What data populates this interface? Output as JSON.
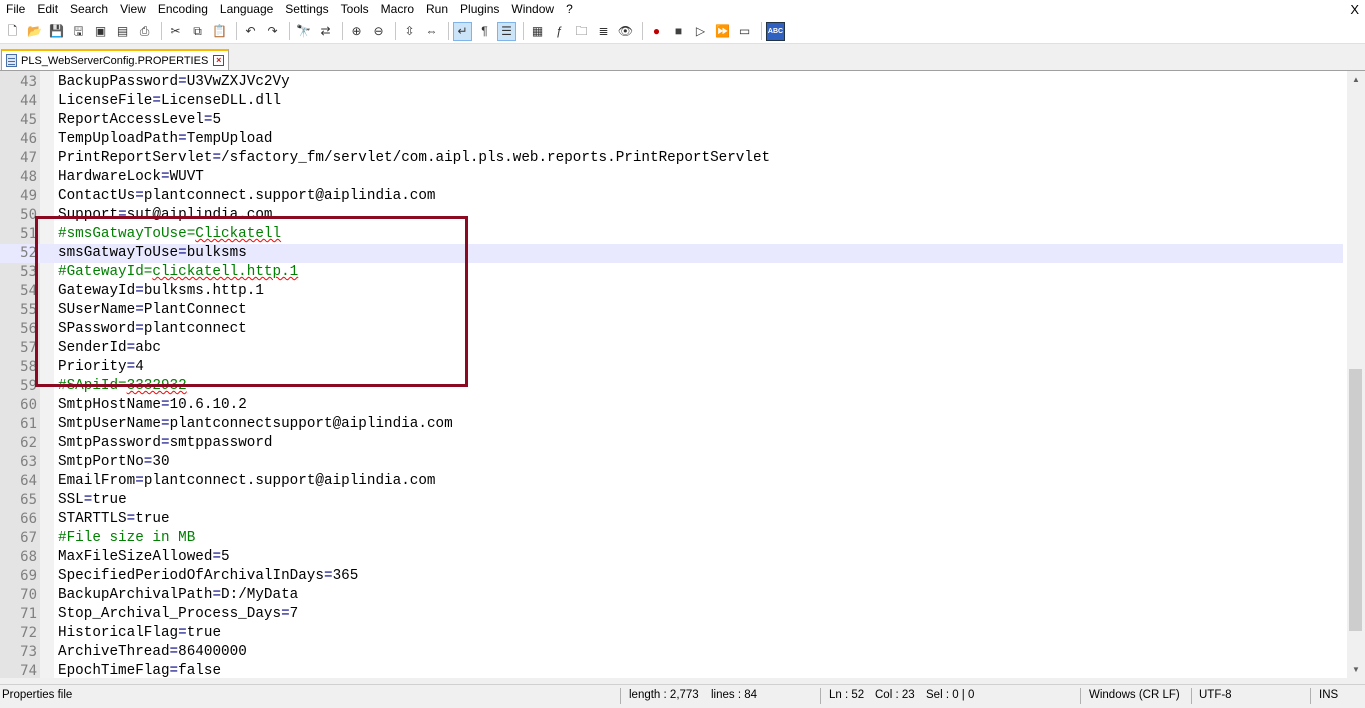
{
  "menu": [
    "File",
    "Edit",
    "Search",
    "View",
    "Encoding",
    "Language",
    "Settings",
    "Tools",
    "Macro",
    "Run",
    "Plugins",
    "Window",
    "?"
  ],
  "window_close": "X",
  "toolbar": {
    "icons": [
      "new-file-icon",
      "open-file-icon",
      "save-icon",
      "save-all-icon",
      "close-icon",
      "close-all-icon",
      "print-icon",
      "cut-icon",
      "copy-icon",
      "paste-icon",
      "undo-icon",
      "redo-icon",
      "find-icon",
      "replace-icon",
      "zoom-in-icon",
      "zoom-out-icon",
      "sync-vertical-icon",
      "sync-horizontal-icon",
      "word-wrap-icon",
      "show-all-chars-icon",
      "indent-guide-icon",
      "doc-map-icon",
      "function-list-icon",
      "folder-workspace-icon",
      "doc-list-icon",
      "monitoring-icon",
      "record-macro-icon",
      "stop-record-icon",
      "playback-macro-icon",
      "run-macro-multiple-icon",
      "save-macro-icon",
      "spell-check-icon"
    ],
    "spell_label": "ABC"
  },
  "tab": {
    "label": "PLS_WebServerConfig.PROPERTIES"
  },
  "editor": {
    "current_line": 52,
    "lines": [
      {
        "n": "43",
        "key": "BackupPassword",
        "eq": "=",
        "val": "U3VwZXJVc2Vy"
      },
      {
        "n": "44",
        "key": "LicenseFile",
        "eq": "=",
        "val": "LicenseDLL.dll"
      },
      {
        "n": "45",
        "key": "ReportAccessLevel",
        "eq": "=",
        "val": "5"
      },
      {
        "n": "46",
        "key": "TempUploadPath",
        "eq": "=",
        "val": "TempUpload"
      },
      {
        "n": "47",
        "key": "PrintReportServlet",
        "eq": "=",
        "val": "/sfactory_fm/servlet/com.aipl.pls.web.reports.PrintReportServlet"
      },
      {
        "n": "48",
        "key": "HardwareLock",
        "eq": "=",
        "val": "WUVT"
      },
      {
        "n": "49",
        "key": "ContactUs",
        "eq": "=",
        "val": "plantconnect.support@aiplindia.com"
      },
      {
        "n": "50",
        "key": "Support",
        "eq": "=",
        "val": "sut@aiplindia.com"
      },
      {
        "n": "51",
        "comment": "#smsGatwayToUse=Clickatell"
      },
      {
        "n": "52",
        "key": "smsGatwayToUse",
        "eq": "=",
        "val": "bulksms"
      },
      {
        "n": "53",
        "comment": "#GatewayId=clickatell.http.1"
      },
      {
        "n": "54",
        "key": "GatewayId",
        "eq": "=",
        "val": "bulksms.http.1"
      },
      {
        "n": "55",
        "key": "SUserName",
        "eq": "=",
        "val": "PlantConnect"
      },
      {
        "n": "56",
        "key": "SPassword",
        "eq": "=",
        "val": "plantconnect"
      },
      {
        "n": "57",
        "key": "SenderId",
        "eq": "=",
        "val": "abc"
      },
      {
        "n": "58",
        "key": "Priority",
        "eq": "=",
        "val": "4"
      },
      {
        "n": "59",
        "comment": "#SApiId=3332932"
      },
      {
        "n": "60",
        "key": "SmtpHostName",
        "eq": "=",
        "val": "10.6.10.2"
      },
      {
        "n": "61",
        "key": "SmtpUserName",
        "eq": "=",
        "val": "plantconnectsupport@aiplindia.com"
      },
      {
        "n": "62",
        "key": "SmtpPassword",
        "eq": "=",
        "val": "smtppassword"
      },
      {
        "n": "63",
        "key": "SmtpPortNo",
        "eq": "=",
        "val": "30"
      },
      {
        "n": "64",
        "key": "EmailFrom",
        "eq": "=",
        "val": "plantconnect.support@aiplindia.com"
      },
      {
        "n": "65",
        "key": "SSL",
        "eq": "=",
        "val": "true"
      },
      {
        "n": "66",
        "key": "STARTTLS",
        "eq": "=",
        "val": "true"
      },
      {
        "n": "67",
        "comment": "#File size in MB"
      },
      {
        "n": "68",
        "key": "MaxFileSizeAllowed",
        "eq": "=",
        "val": "5"
      },
      {
        "n": "69",
        "key": "SpecifiedPeriodOfArchivalInDays",
        "eq": "=",
        "val": "365"
      },
      {
        "n": "70",
        "key": "BackupArchivalPath",
        "eq": "=",
        "val": "D:/MyData"
      },
      {
        "n": "71",
        "key": "Stop_Archival_Process_Days",
        "eq": "=",
        "val": "7"
      },
      {
        "n": "72",
        "key": "HistoricalFlag",
        "eq": "=",
        "val": "true"
      },
      {
        "n": "73",
        "key": "ArchiveThread",
        "eq": "=",
        "val": "86400000"
      },
      {
        "n": "74",
        "key": "EpochTimeFlag",
        "eq": "=",
        "val": "false"
      }
    ]
  },
  "status": {
    "file_type": "Properties file",
    "length": "length : 2,773",
    "lines": "lines : 84",
    "ln": "Ln : 52",
    "col": "Col : 23",
    "sel": "Sel : 0 | 0",
    "eol": "Windows (CR LF)",
    "encoding": "UTF-8",
    "mode": "INS"
  },
  "colors": {
    "highlight_box": "#8b0a22",
    "comment": "#008000",
    "operator": "#000080",
    "current_line": "#e8e8ff",
    "tab_accent": "#fab800"
  }
}
